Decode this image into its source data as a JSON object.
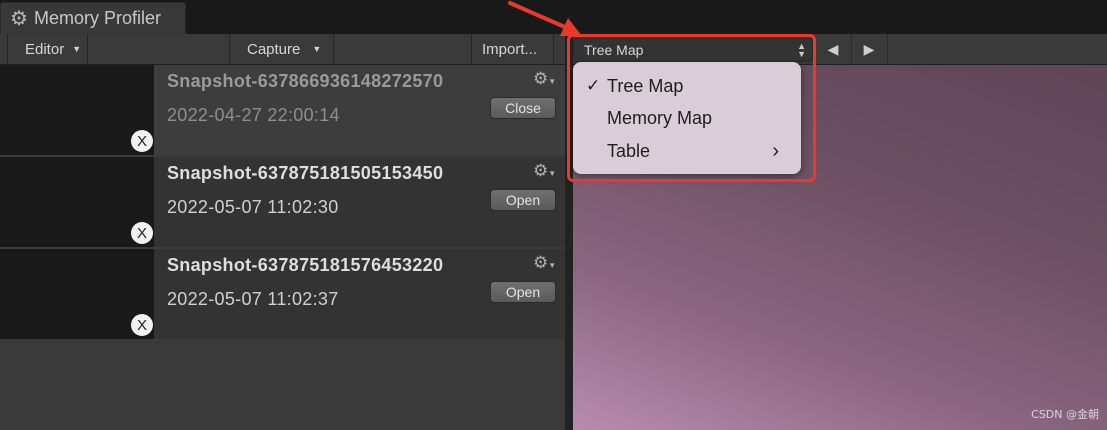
{
  "window": {
    "tab_title": "Memory Profiler",
    "tab_icon": "gear-cog-icon"
  },
  "toolbar": {
    "editor_label": "Editor",
    "capture_label": "Capture",
    "import_label": "Import..."
  },
  "snapshots": [
    {
      "name": "Snapshot-637866936148272570",
      "date": "2022-04-27 22:00:14",
      "button": "Close",
      "name_color": "#9a9a9a",
      "date_color": "#8e8e8e"
    },
    {
      "name": "Snapshot-637875181505153450",
      "date": "2022-05-07 11:02:30",
      "button": "Open",
      "name_color": "#dedede",
      "date_color": "#d0d0d0"
    },
    {
      "name": "Snapshot-637875181576453220",
      "date": "2022-05-07 11:02:37",
      "button": "Open",
      "name_color": "#dedede",
      "date_color": "#d0d0d0"
    }
  ],
  "close_mark": "X",
  "view": {
    "selected": "Tree Map",
    "back_icon": "◀",
    "forward_icon": "▶"
  },
  "menu": {
    "check_mark": "✓",
    "submenu_mark": "›",
    "items": [
      {
        "label": "Tree Map",
        "checked": true
      },
      {
        "label": "Memory Map",
        "checked": false
      },
      {
        "label": "Table",
        "checked": false,
        "has_submenu": true
      }
    ]
  },
  "annotation": {
    "color": "#e8392b"
  },
  "watermark": "CSDN @金朝"
}
